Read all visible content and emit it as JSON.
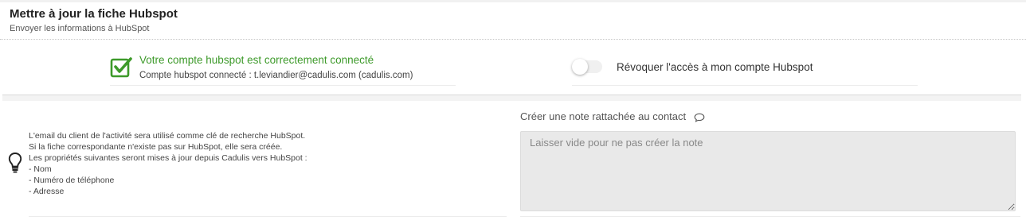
{
  "header": {
    "title": "Mettre à jour la fiche Hubspot",
    "subtitle": "Envoyer les informations à HubSpot"
  },
  "connection": {
    "status_text": "Votre compte hubspot est correctement connecté",
    "account_text": "Compte hubspot connecté : t.leviandier@cadulis.com (cadulis.com)",
    "status_color": "#3d9a2a",
    "icon": "checkbox-checked-icon"
  },
  "revoke": {
    "label": "Révoquer l'accès à mon compte Hubspot",
    "enabled": false
  },
  "info": {
    "icon": "lightbulb-icon",
    "lines": [
      "L'email du client de l'activité sera utilisé comme clé de recherche HubSpot.",
      "Si la fiche correspondante n'existe pas sur HubSpot, elle sera créée.",
      "Les propriétés suivantes seront mises à jour depuis Cadulis vers HubSpot :",
      "- Nom",
      "- Numéro de téléphone",
      "- Adresse"
    ]
  },
  "note": {
    "label": "Créer une note rattachée au contact",
    "icon": "comment-icon",
    "placeholder": "Laisser vide pour ne pas créer la note",
    "value": ""
  }
}
